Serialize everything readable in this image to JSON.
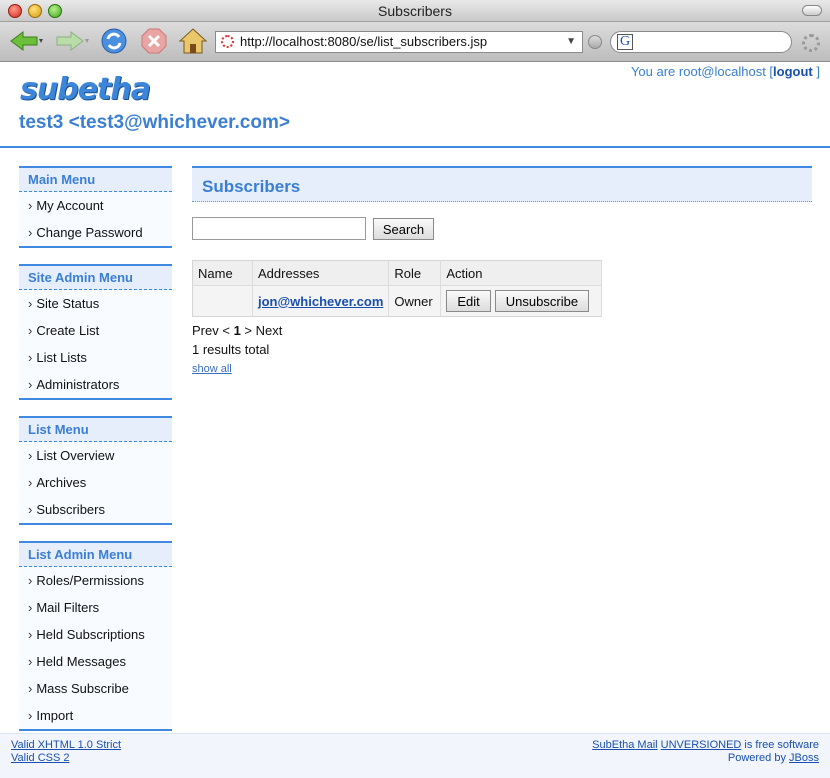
{
  "window": {
    "title": "Subscribers"
  },
  "browser": {
    "url": "http://localhost:8080/se/list_subscribers.jsp",
    "search_engine_icon": "G"
  },
  "header": {
    "logo_text": "subetha",
    "user_prefix": "You are root@localhost [",
    "logout_label": "logout",
    "user_suffix": " ]",
    "list_title": "test3 <test3@whichever.com>"
  },
  "sidebar": {
    "menus": [
      {
        "title": "Main Menu",
        "items": [
          "My Account",
          "Change Password"
        ]
      },
      {
        "title": "Site Admin Menu",
        "items": [
          "Site Status",
          "Create List",
          "List Lists",
          "Administrators"
        ]
      },
      {
        "title": "List Menu",
        "items": [
          "List Overview",
          "Archives",
          "Subscribers"
        ]
      },
      {
        "title": "List Admin Menu",
        "items": [
          "Roles/Permissions",
          "Mail Filters",
          "Held Subscriptions",
          "Held Messages",
          "Mass Subscribe",
          "Import"
        ]
      }
    ]
  },
  "main": {
    "title": "Subscribers",
    "search_button": "Search",
    "search_value": "",
    "table": {
      "headers": [
        "Name",
        "Addresses",
        "Role",
        "Action"
      ],
      "rows": [
        {
          "name": "",
          "address": "jon@whichever.com",
          "role": "Owner",
          "edit_label": "Edit",
          "unsubscribe_label": "Unsubscribe"
        }
      ]
    },
    "pager": {
      "prev": "Prev <",
      "current": "1",
      "next": "> Next"
    },
    "results_total": "1 results total",
    "show_all": "show all"
  },
  "footer": {
    "valid_xhtml": "Valid XHTML 1.0 Strict",
    "valid_css": "Valid CSS 2",
    "product": "SubEtha Mail",
    "version": "UNVERSIONED",
    "free_text": " is free software",
    "powered_by": "Powered by ",
    "jboss": "JBoss"
  }
}
